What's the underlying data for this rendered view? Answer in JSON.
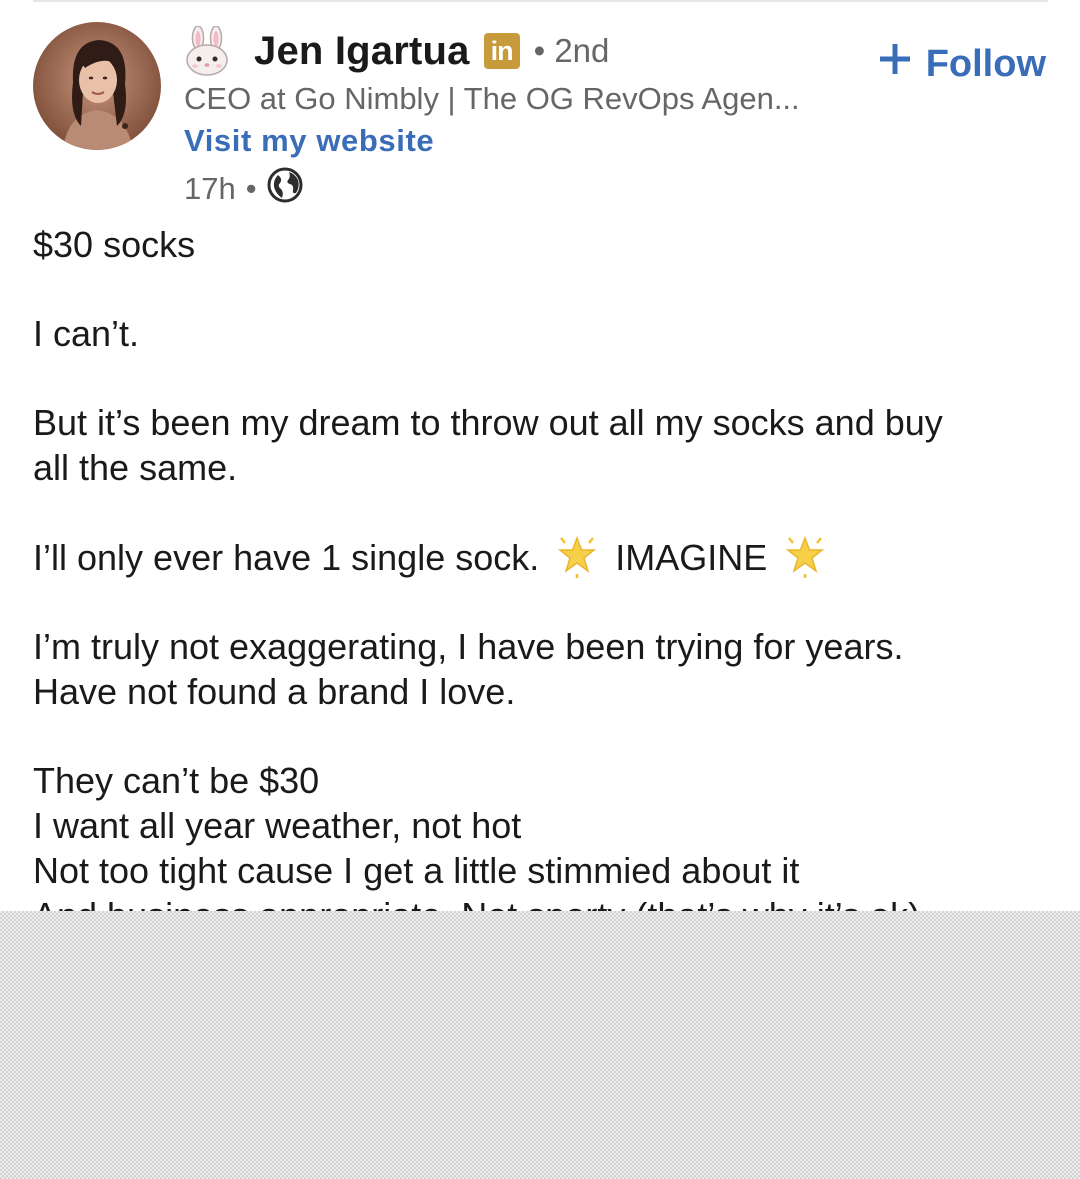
{
  "author": {
    "emoji_icon": "rabbit-face-icon",
    "name": "Jen Igartua",
    "badge": "in",
    "connection_degree": "• 2nd",
    "headline": "CEO at Go Nimbly | The OG RevOps Agen...",
    "website_link": "Visit my website",
    "timestamp": "17h",
    "meta_separator": "•",
    "visibility_icon": "globe-icon"
  },
  "follow": {
    "plus": "+",
    "label": "Follow"
  },
  "post": {
    "line1": "$30 socks",
    "line2": "I can’t.",
    "line3a": "But it’s been my dream to throw out all my socks and buy",
    "line3b": "all the same.",
    "line4_text": "I’ll only ever have 1 single sock.",
    "line4_word": "IMAGINE",
    "line5a": "I’m truly not exaggerating, I have been trying for years.",
    "line5b": "Have not found a brand I love.",
    "line6a": "They can’t be $30",
    "line6b": "I want all year weather, not hot",
    "line6c": "Not too tight cause I get a little stimmied about it",
    "line6d": "And business appropriate. Not sporty (that’s why it’s ok)"
  },
  "colors": {
    "link_blue": "#3a6db8",
    "badge_gold": "#c79a3c",
    "secondary_text": "#666666"
  }
}
